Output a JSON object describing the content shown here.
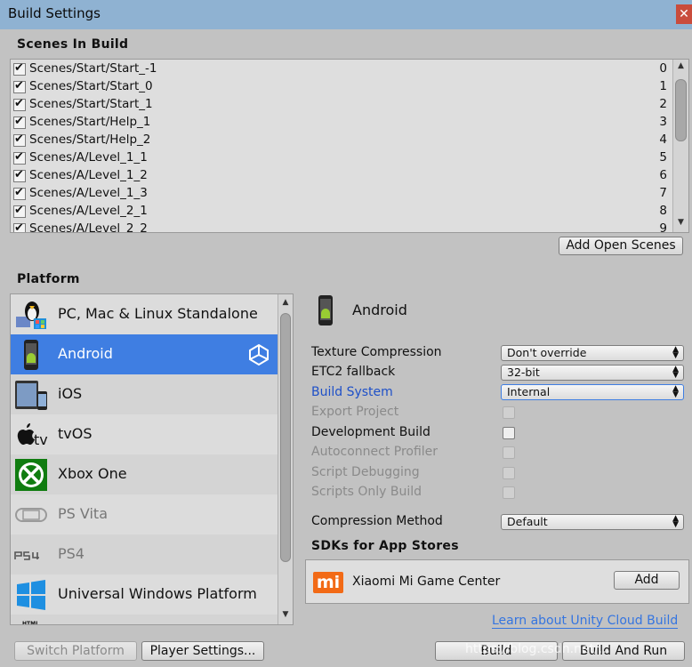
{
  "window": {
    "title": "Build Settings",
    "close_label": "✕"
  },
  "scenes": {
    "header": "Scenes In Build",
    "items": [
      {
        "path": "Scenes/Start/Start_-1",
        "index": "0"
      },
      {
        "path": "Scenes/Start/Start_0",
        "index": "1"
      },
      {
        "path": "Scenes/Start/Start_1",
        "index": "2"
      },
      {
        "path": "Scenes/Start/Help_1",
        "index": "3"
      },
      {
        "path": "Scenes/Start/Help_2",
        "index": "4"
      },
      {
        "path": "Scenes/A/Level_1_1",
        "index": "5"
      },
      {
        "path": "Scenes/A/Level_1_2",
        "index": "6"
      },
      {
        "path": "Scenes/A/Level_1_3",
        "index": "7"
      },
      {
        "path": "Scenes/A/Level_2_1",
        "index": "8"
      },
      {
        "path": "Scenes/A/Level_2_2",
        "index": "9"
      }
    ],
    "add_open_scenes": "Add Open Scenes"
  },
  "platform": {
    "header": "Platform",
    "items": [
      {
        "name": "PC, Mac & Linux Standalone",
        "icon": "linux-tux-icon"
      },
      {
        "name": "Android",
        "icon": "android-phone-icon",
        "selected": true
      },
      {
        "name": "iOS",
        "icon": "ios-devices-icon"
      },
      {
        "name": "tvOS",
        "icon": "apple-tv-icon"
      },
      {
        "name": "Xbox One",
        "icon": "xbox-icon"
      },
      {
        "name": "PS Vita",
        "icon": "ps-vita-icon"
      },
      {
        "name": "PS4",
        "icon": "ps4-icon"
      },
      {
        "name": "Universal Windows Platform",
        "icon": "windows-icon"
      },
      {
        "name": "",
        "icon": "html5-icon"
      }
    ]
  },
  "settings": {
    "platform_title": "Android",
    "texture_compression": {
      "label": "Texture Compression",
      "value": "Don't override"
    },
    "etc2_fallback": {
      "label": "ETC2 fallback",
      "value": "32-bit"
    },
    "build_system": {
      "label": "Build System",
      "value": "Internal"
    },
    "export_project": {
      "label": "Export Project"
    },
    "development_build": {
      "label": "Development Build"
    },
    "autoconnect_profiler": {
      "label": "Autoconnect Profiler"
    },
    "script_debugging": {
      "label": "Script Debugging"
    },
    "scripts_only_build": {
      "label": "Scripts Only Build"
    },
    "compression_method": {
      "label": "Compression Method",
      "value": "Default"
    },
    "sdk_header": "SDKs for App Stores",
    "sdk": {
      "logo": "mi",
      "name": "Xiaomi Mi Game Center",
      "add_label": "Add"
    },
    "cloud_link": "Learn about Unity Cloud Build"
  },
  "footer": {
    "switch_platform": "Switch Platform",
    "player_settings": "Player Settings...",
    "build": "Build",
    "build_and_run": "Build And Run",
    "watermark": "https://blog.csdn.net/..."
  },
  "colors": {
    "selection": "#3f7ee2",
    "link": "#3575e0",
    "titlebar": "#8fb2d2",
    "mi_orange": "#f26a16"
  }
}
